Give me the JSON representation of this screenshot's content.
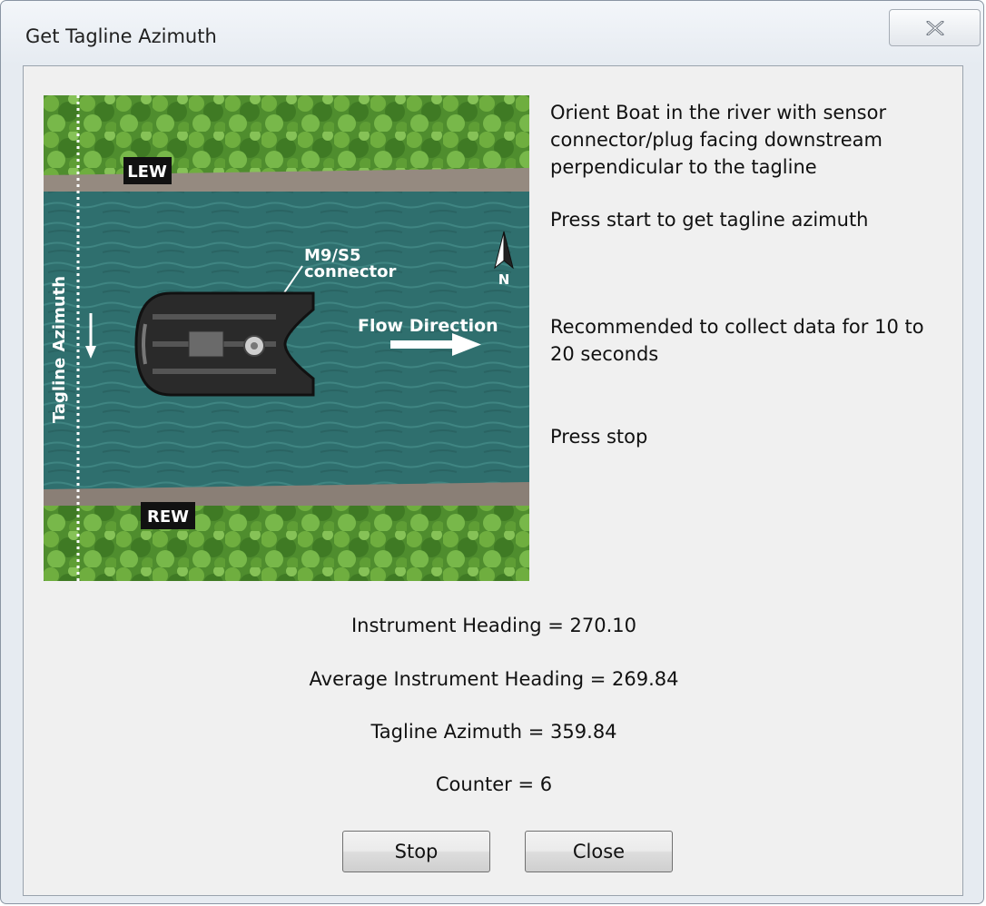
{
  "window": {
    "title": "Get Tagline Azimuth"
  },
  "illustration": {
    "lew_label": "LEW",
    "rew_label": "REW",
    "tagline_label": "Tagline Azimuth",
    "connector_label_line1": "M9/S5",
    "connector_label_line2": "connector",
    "flow_label": "Flow Direction",
    "north_label": "N"
  },
  "instructions": {
    "step1_line1": "Orient Boat in the river with sensor",
    "step1_line2": "connector/plug facing downstream",
    "step1_line3": "perpendicular to the tagline",
    "step2": "Press start to get tagline azimuth",
    "step3_line1": "Recommended to collect data for 10 to",
    "step3_line2": "20 seconds",
    "step4": "Press stop"
  },
  "readouts": {
    "instrument_heading": "Instrument Heading = 270.10",
    "average_heading": "Average Instrument Heading = 269.84",
    "tagline_azimuth": "Tagline Azimuth = 359.84",
    "counter": "Counter = 6"
  },
  "buttons": {
    "stop": "Stop",
    "close": "Close"
  },
  "colors": {
    "water": "#2f6f6e",
    "vegetation": "#4a8a2c",
    "bank": "#8d8279"
  }
}
